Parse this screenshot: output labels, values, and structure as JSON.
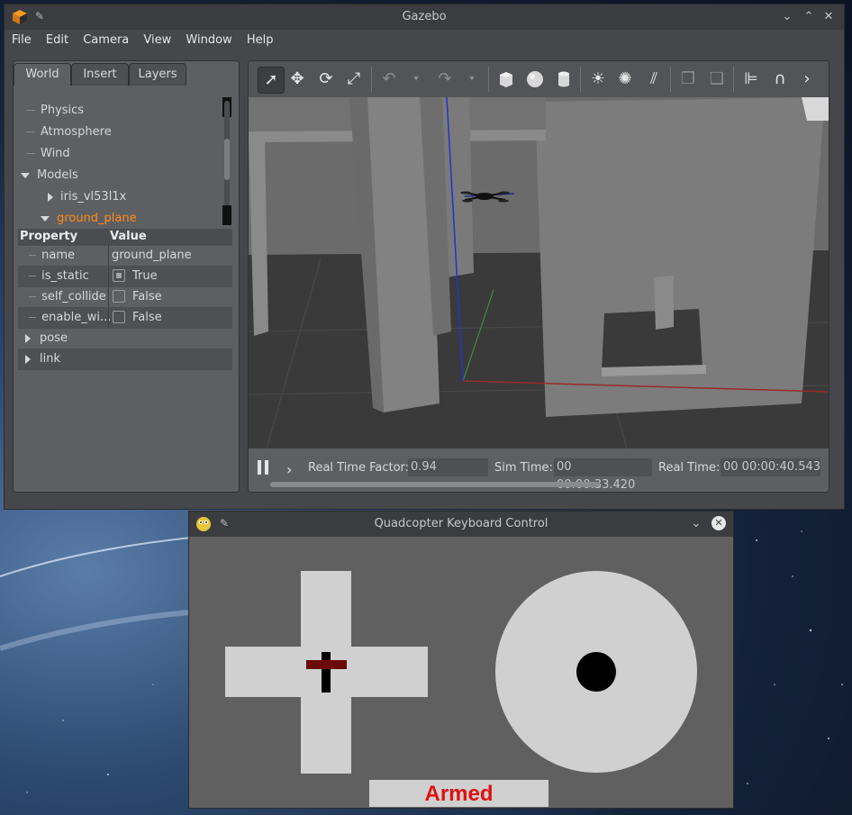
{
  "gazebo": {
    "title": "Gazebo",
    "menu": [
      "File",
      "Edit",
      "Camera",
      "View",
      "Window",
      "Help"
    ],
    "tabs": [
      "World",
      "Insert",
      "Layers"
    ],
    "active_tab": "World",
    "tree": {
      "items": [
        {
          "label": "Physics",
          "level": 1,
          "expander": "none"
        },
        {
          "label": "Atmosphere",
          "level": 1,
          "expander": "none"
        },
        {
          "label": "Wind",
          "level": 1,
          "expander": "none"
        },
        {
          "label": "Models",
          "level": 0,
          "expander": "expanded"
        },
        {
          "label": "iris_vl53l1x",
          "level": 1,
          "expander": "collapsed"
        },
        {
          "label": "ground_plane",
          "level": 1,
          "expander": "expanded",
          "selected": true
        }
      ]
    },
    "properties": {
      "headers": [
        "Property",
        "Value"
      ],
      "rows": [
        {
          "name": "name",
          "value": "ground_plane",
          "type": "text"
        },
        {
          "name": "is_static",
          "value": "True",
          "type": "checkbox",
          "checked": true
        },
        {
          "name": "self_collide",
          "value": "False",
          "type": "checkbox",
          "checked": false
        },
        {
          "name": "enable_wi...",
          "value": "False",
          "type": "checkbox",
          "checked": false
        },
        {
          "name": "pose",
          "type": "group"
        },
        {
          "name": "link",
          "type": "group"
        }
      ]
    },
    "toolbar_icons": [
      "select-icon",
      "translate-icon",
      "rotate-icon",
      "scale-icon",
      "undo-icon",
      "undo-history-icon",
      "redo-icon",
      "redo-history-icon",
      "box-icon",
      "sphere-icon",
      "cylinder-icon",
      "point-light-icon",
      "spot-light-icon",
      "directional-light-icon",
      "copy-icon",
      "paste-icon",
      "align-icon",
      "snap-icon",
      "more-icon"
    ],
    "status": {
      "real_time_factor_label": "Real Time Factor:",
      "real_time_factor": "0.94",
      "sim_time_label": "Sim Time:",
      "sim_time": "00 00:00:33.420",
      "real_time_label": "Real Time:",
      "real_time": "00 00:00:40.543"
    }
  },
  "keyboard_control": {
    "title": "Quadcopter Keyboard Control",
    "status": "Armed",
    "colors": {
      "status": "#e01010",
      "pad": "#d0d0d0",
      "background": "#606060",
      "marker_h": "#6b0a0a",
      "marker_v": "#000000"
    }
  }
}
